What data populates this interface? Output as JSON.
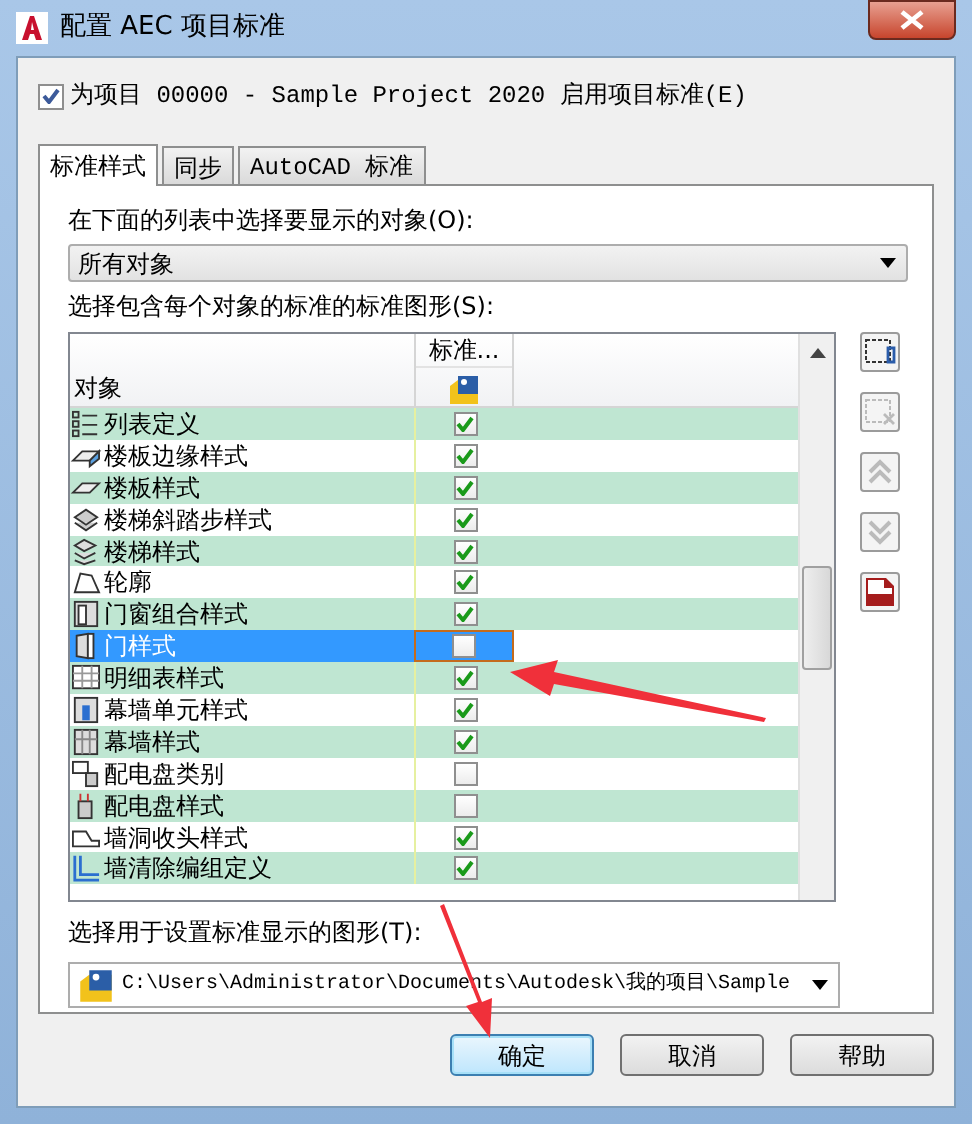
{
  "window": {
    "title": "配置 AEC 项目标准"
  },
  "enable": {
    "label": "为项目 00000 - Sample Project 2020 启用项目标准(E)",
    "checked": true
  },
  "tabs": [
    {
      "label": "标准样式",
      "selected": true
    },
    {
      "label": "同步",
      "selected": false
    },
    {
      "label": "AutoCAD 标准",
      "selected": false
    }
  ],
  "object_filter": {
    "label": "在下面的列表中选择要显示的对象(O):",
    "value": "所有对象"
  },
  "list_label": "选择包含每个对象的标准的标准图形(S):",
  "table": {
    "columns": [
      "对象",
      "标准..."
    ],
    "rows": [
      {
        "name": "列表定义",
        "checked": true,
        "selected": false
      },
      {
        "name": "楼板边缘样式",
        "checked": true,
        "selected": false
      },
      {
        "name": "楼板样式",
        "checked": true,
        "selected": false
      },
      {
        "name": "楼梯斜踏步样式",
        "checked": true,
        "selected": false
      },
      {
        "name": "楼梯样式",
        "checked": true,
        "selected": false
      },
      {
        "name": "轮廓",
        "checked": true,
        "selected": false
      },
      {
        "name": "门窗组合样式",
        "checked": true,
        "selected": false
      },
      {
        "name": "门样式",
        "checked": false,
        "selected": true
      },
      {
        "name": "明细表样式",
        "checked": true,
        "selected": false
      },
      {
        "name": "幕墙单元样式",
        "checked": true,
        "selected": false
      },
      {
        "name": "幕墙样式",
        "checked": true,
        "selected": false
      },
      {
        "name": "配电盘类别",
        "checked": false,
        "selected": false
      },
      {
        "name": "配电盘样式",
        "checked": false,
        "selected": false
      },
      {
        "name": "墙洞收头样式",
        "checked": true,
        "selected": false
      },
      {
        "name": "墙清除编组定义",
        "checked": true,
        "selected": false
      }
    ]
  },
  "display_drawing": {
    "label": "选择用于设置标准显示的图形(T):",
    "value": "C:\\Users\\Administrator\\Documents\\Autodesk\\我的项目\\Sample"
  },
  "buttons": [
    {
      "label": "确定",
      "kind": "default"
    },
    {
      "label": "取消",
      "kind": "normal"
    },
    {
      "label": "帮助",
      "kind": "normal"
    }
  ]
}
